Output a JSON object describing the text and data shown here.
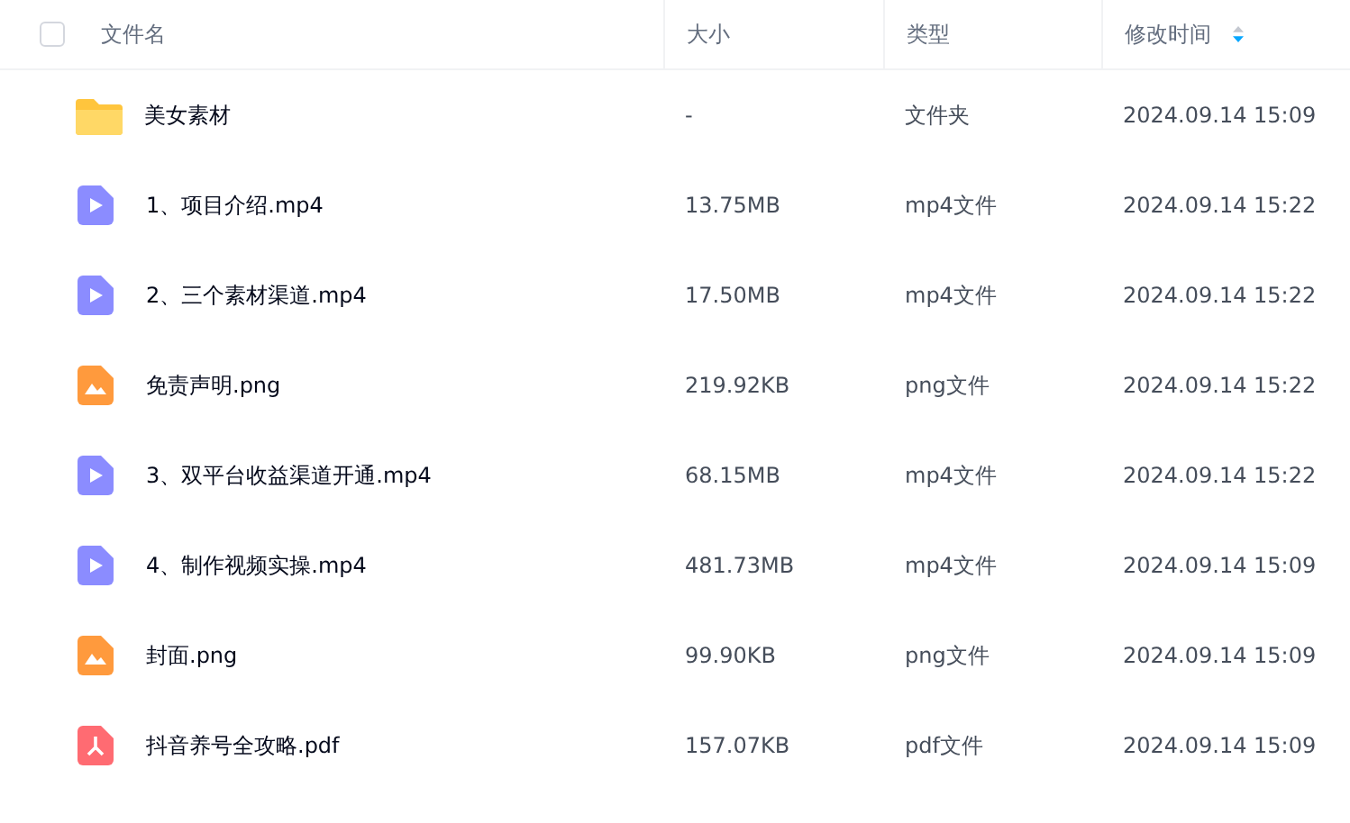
{
  "header": {
    "select_all": {
      "checked": false
    },
    "columns": [
      {
        "label": "文件名"
      },
      {
        "label": "大小"
      },
      {
        "label": "类型"
      },
      {
        "label": "修改时间",
        "sorted": true,
        "descending": true
      }
    ]
  },
  "rows": [
    {
      "kind": "folder",
      "name": "美女素材",
      "size": "-",
      "type": "文件夹",
      "modified": "2024.09.14 15:09"
    },
    {
      "kind": "video",
      "name": "1、项目介绍.mp4",
      "size": "13.75MB",
      "type": "mp4文件",
      "modified": "2024.09.14 15:22"
    },
    {
      "kind": "video",
      "name": "2、三个素材渠道.mp4",
      "size": "17.50MB",
      "type": "mp4文件",
      "modified": "2024.09.14 15:22"
    },
    {
      "kind": "image",
      "name": "免责声明.png",
      "size": "219.92KB",
      "type": "png文件",
      "modified": "2024.09.14 15:22"
    },
    {
      "kind": "video",
      "name": "3、双平台收益渠道开通.mp4",
      "size": "68.15MB",
      "type": "mp4文件",
      "modified": "2024.09.14 15:22"
    },
    {
      "kind": "video",
      "name": "4、制作视频实操.mp4",
      "size": "481.73MB",
      "type": "mp4文件",
      "modified": "2024.09.14 15:09"
    },
    {
      "kind": "image",
      "name": "封面.png",
      "size": "99.90KB",
      "type": "png文件",
      "modified": "2024.09.14 15:09"
    },
    {
      "kind": "pdf",
      "name": "抖音养号全攻略.pdf",
      "size": "157.07KB",
      "type": "pdf文件",
      "modified": "2024.09.14 15:09"
    }
  ]
}
